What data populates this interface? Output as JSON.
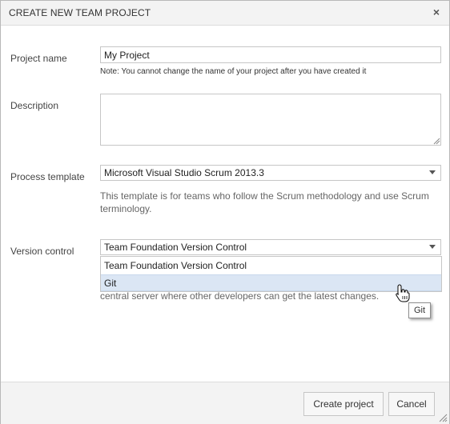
{
  "dialog": {
    "title": "CREATE NEW TEAM PROJECT",
    "close_icon": "close-icon"
  },
  "form": {
    "project_name_label": "Project name",
    "project_name_value": "My Project",
    "project_name_note": "Note: You cannot change the name of your project after you have created it",
    "description_label": "Description",
    "description_value": "",
    "process_template_label": "Process template",
    "process_template_value": "Microsoft Visual Studio Scrum 2013.3",
    "process_template_description": "This template is for teams who follow the Scrum methodology and use Scrum terminology.",
    "version_control_label": "Version control",
    "version_control_value": "Team Foundation Version Control",
    "version_control_options": [
      "Team Foundation Version Control",
      "Git"
    ],
    "version_control_hover_option": "Git",
    "version_control_description_partial": "central server where other developers can get the latest changes.",
    "tooltip": "Git"
  },
  "footer": {
    "create_label": "Create project",
    "cancel_label": "Cancel"
  },
  "colors": {
    "hover_highlight": "#dbe6f4",
    "titlebar_bg": "#f3f3f3"
  }
}
